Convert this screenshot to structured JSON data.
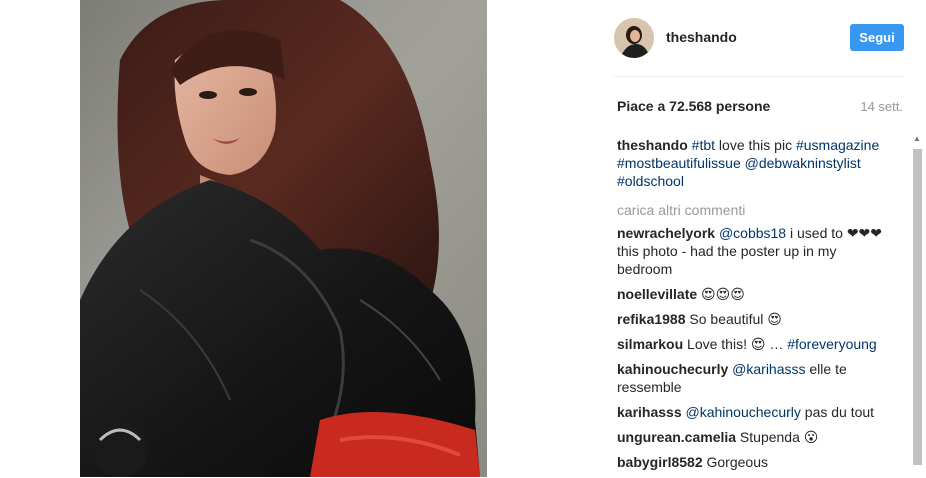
{
  "post": {
    "username": "theshando",
    "follow_label": "Segui",
    "likes": "Piace a 72.568 persone",
    "date": "14 sett."
  },
  "caption": {
    "user": "theshando",
    "parts": [
      "#tbt",
      " love this pic ",
      "#usmagazine",
      " ",
      "#mostbeautifulissue",
      " ",
      "@debwakninstylist",
      " ",
      "#oldschool"
    ]
  },
  "load_more": "carica altri commenti",
  "comments": [
    {
      "user": "newrachelyork",
      "mention": "@cobbs18",
      "text": " i used to ❤❤❤ this photo - had the poster up in my bedroom"
    },
    {
      "user": "noellevillate",
      "text": " 😍😍😍"
    },
    {
      "user": "refika1988",
      "text": " So beautiful 😍"
    },
    {
      "user": "silmarkou",
      "text": " Love this! 😍 … ",
      "hashtag": "#foreveryoung"
    },
    {
      "user": "kahinouchecurly",
      "mention": "@karihasss",
      "text": " elle te ressemble"
    },
    {
      "user": "karihasss",
      "mention": "@kahinouchecurly",
      "text": " pas du tout"
    },
    {
      "user": "ungurean.camelia",
      "text": " Stupenda 😮"
    },
    {
      "user": "babygirl8582",
      "text": " Gorgeous"
    }
  ]
}
